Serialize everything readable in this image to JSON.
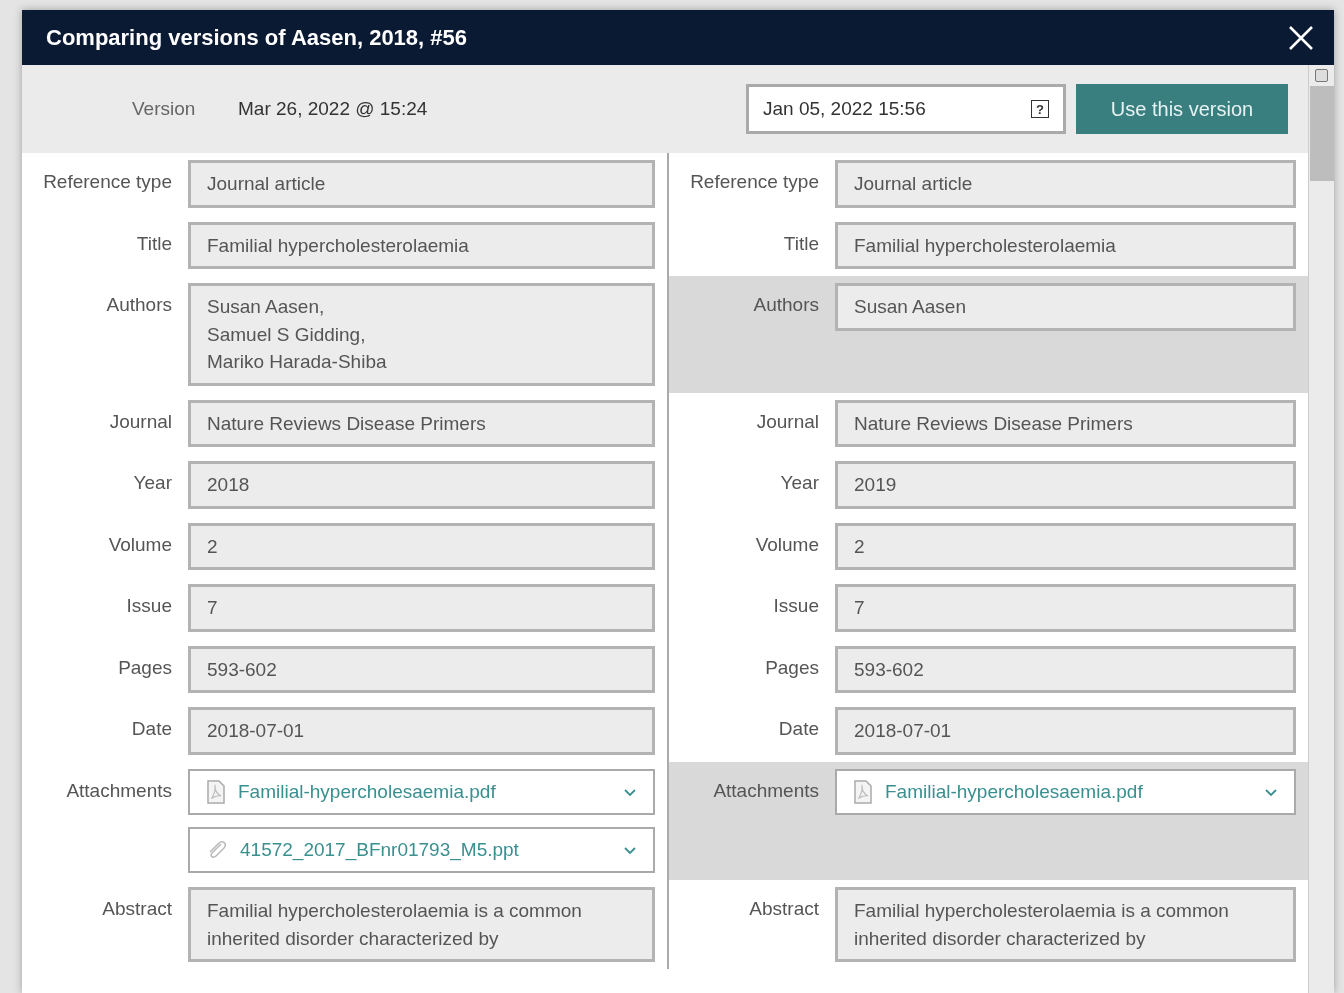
{
  "dialog": {
    "title": "Comparing versions of Aasen, 2018, #56"
  },
  "version_bar": {
    "label": "Version",
    "current": "Mar 26, 2022 @ 15:24",
    "picker_value": "Jan 05, 2022 15:56",
    "picker_icon": "?",
    "button": "Use this version"
  },
  "panes": [
    {
      "fields": [
        {
          "kind": "text",
          "label": "Reference type",
          "value": "Journal article",
          "differs": false
        },
        {
          "kind": "text",
          "label": "Title",
          "value": "Familial hypercholesterolaemia",
          "differs": false
        },
        {
          "kind": "lines",
          "label": "Authors",
          "lines": [
            "Susan Aasen,",
            "Samuel S Gidding,",
            "Mariko Harada-Shiba"
          ],
          "differs": false
        },
        {
          "kind": "text",
          "label": "Journal",
          "value": "Nature Reviews Disease Primers",
          "differs": false
        },
        {
          "kind": "text",
          "label": "Year",
          "value": "2018",
          "differs": false
        },
        {
          "kind": "text",
          "label": "Volume",
          "value": "2",
          "differs": false
        },
        {
          "kind": "text",
          "label": "Issue",
          "value": "7",
          "differs": false
        },
        {
          "kind": "text",
          "label": "Pages",
          "value": "593-602",
          "differs": false
        },
        {
          "kind": "text",
          "label": "Date",
          "value": "2018-07-01",
          "differs": false
        },
        {
          "kind": "attachments",
          "label": "Attachments",
          "files": [
            {
              "name": "Familial-hypercholesaemia.pdf",
              "kind": "pdf"
            },
            {
              "name": "41572_2017_BFnr01793_M5.ppt",
              "kind": "clip"
            }
          ],
          "differs": false
        },
        {
          "kind": "text",
          "label": "Abstract",
          "value": "Familial hypercholesterolaemia is a common inherited disorder characterized by",
          "differs": false
        }
      ]
    },
    {
      "fields": [
        {
          "kind": "text",
          "label": "Reference type",
          "value": "Journal article",
          "differs": false
        },
        {
          "kind": "text",
          "label": "Title",
          "value": "Familial hypercholesterolaemia",
          "differs": false
        },
        {
          "kind": "lines",
          "label": "Authors",
          "lines": [
            "Susan Aasen"
          ],
          "differs": true
        },
        {
          "kind": "text",
          "label": "Journal",
          "value": "Nature Reviews Disease Primers",
          "differs": false
        },
        {
          "kind": "text",
          "label": "Year",
          "value": "2019",
          "differs": false
        },
        {
          "kind": "text",
          "label": "Volume",
          "value": "2",
          "differs": false
        },
        {
          "kind": "text",
          "label": "Issue",
          "value": "7",
          "differs": false
        },
        {
          "kind": "text",
          "label": "Pages",
          "value": "593-602",
          "differs": false
        },
        {
          "kind": "text",
          "label": "Date",
          "value": "2018-07-01",
          "differs": false
        },
        {
          "kind": "attachments",
          "label": "Attachments",
          "files": [
            {
              "name": "Familial-hypercholesaemia.pdf",
              "kind": "pdf"
            }
          ],
          "differs": true
        },
        {
          "kind": "text",
          "label": "Abstract",
          "value": "Familial hypercholesterolaemia is a common inherited disorder characterized by",
          "differs": false
        }
      ]
    }
  ]
}
